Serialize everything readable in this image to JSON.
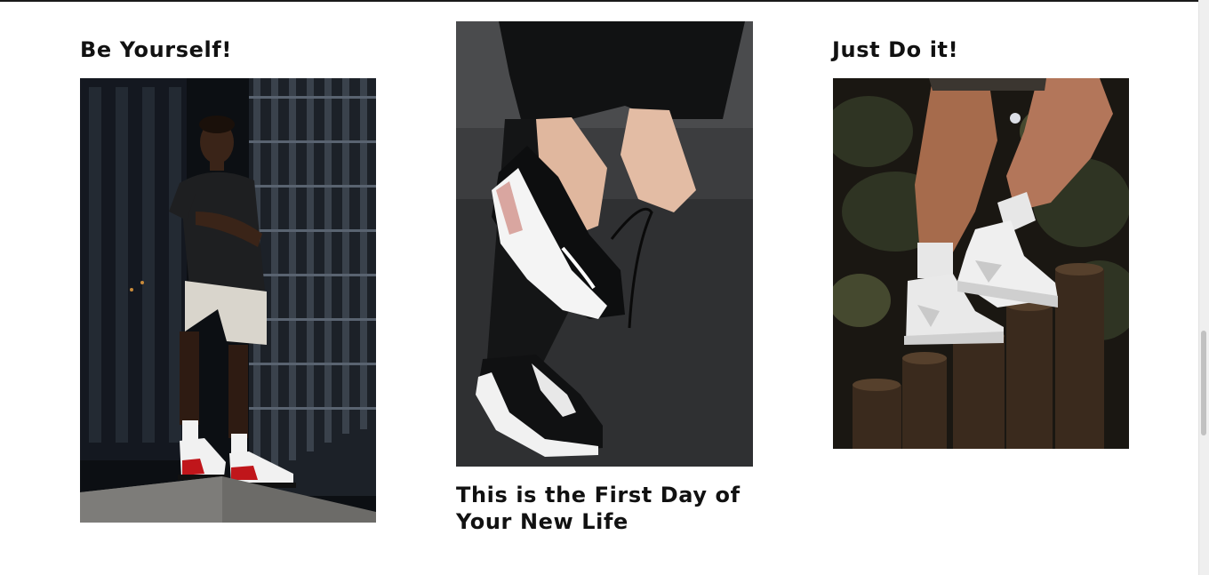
{
  "cards": [
    {
      "title": "Be Yourself!"
    },
    {
      "title": "This is the First Day of Your New Life"
    },
    {
      "title": "Just Do it!"
    }
  ],
  "icons": {
    "card1": "photo-man-standing-sneakers",
    "card2": "photo-hands-lacing-sneaker",
    "card3": "photo-legs-white-high-top-sneakers"
  },
  "colors": {
    "text": "#111111",
    "background": "#ffffff",
    "scrollbar_track": "#efefef",
    "scrollbar_thumb": "#c1c1c1"
  }
}
